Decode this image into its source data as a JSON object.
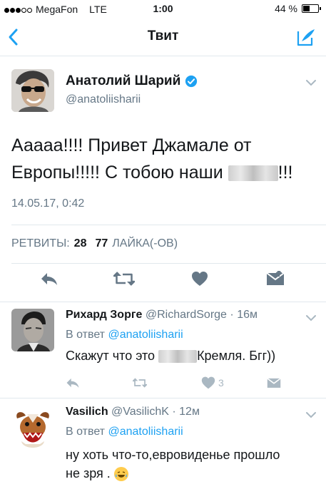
{
  "status_bar": {
    "carrier": "MegaFon",
    "network": "LTE",
    "time": "1:00",
    "battery": "44 %",
    "battery_level": 0.44
  },
  "nav": {
    "title": "Твит",
    "back_icon": "chevron-left-icon",
    "compose_icon": "compose-icon"
  },
  "tweet": {
    "author_name": "Анатолий Шарий",
    "handle": "@anatoliisharii",
    "text_line1": "Ааааа!!!! Привет Джамале от",
    "text_line2_start": "Европы!!!!! С тобою наши",
    "text_line2_end": "!!!",
    "date": "14.05.17, 0:42",
    "retweets_label": "РЕТВИТЫ:",
    "retweets_count": "28",
    "likes_count": "77",
    "likes_label": "ЛАЙКА(-ОВ)"
  },
  "replies": [
    {
      "name": "Рихард Зорге",
      "handle": "@RichardSorge",
      "time": "16м",
      "in_reply_prefix": "В ответ",
      "in_reply_handle": "@anatoliisharii",
      "text_start": "Скажут что это",
      "text_end": "Кремля. Бгг))",
      "likes": "3"
    },
    {
      "name": "Vasilich",
      "handle": "@VasilichK",
      "time": "12м",
      "in_reply_prefix": "В ответ",
      "in_reply_handle": "@anatoliisharii",
      "text_line1": "ну хоть что-то,евровиденье прошло",
      "text_line2": "не зря ."
    }
  ],
  "colors": {
    "accent": "#1da1f2",
    "secondary_text": "#657786",
    "action_icon": "#657786",
    "reply_action_icon": "#aab8c2",
    "divider": "#e1e8ed"
  }
}
